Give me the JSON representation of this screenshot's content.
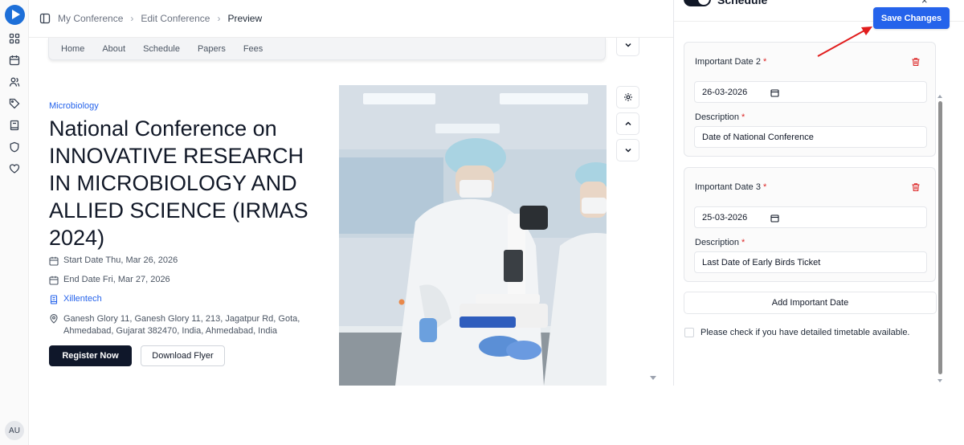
{
  "rail": {
    "avatar_initials": "AU",
    "icons": [
      "grid-icon",
      "calendar-icon",
      "users-icon",
      "tag-icon",
      "book-icon",
      "shield-icon",
      "heart-icon"
    ]
  },
  "breadcrumb": {
    "items": [
      "My Conference",
      "Edit Conference"
    ],
    "current": "Preview"
  },
  "preview": {
    "nav": [
      "Home",
      "About",
      "Schedule",
      "Papers",
      "Fees"
    ],
    "category": "Microbiology",
    "title": "National Conference on INNOVATIVE RESEARCH IN MICROBIOLOGY AND ALLIED SCIENCE (IRMAS 2024)",
    "start_date": "Start Date Thu, Mar 26, 2026",
    "end_date": "End Date Fri, Mar 27, 2026",
    "organizer": "Xillentech",
    "address": "Ganesh Glory 11, Ganesh Glory 11, 213, Jagatpur Rd, Gota, Ahmedabad, Gujarat 382470, India, Ahmedabad, India",
    "register_label": "Register Now",
    "flyer_label": "Download Flyer"
  },
  "panel": {
    "section_title": "Schedule",
    "close_glyph": "×",
    "save_label": "Save Changes",
    "dates": [
      {
        "label": "Important Date 2",
        "date": "26-03-2026",
        "desc_label": "Description",
        "description": "Date of National Conference"
      },
      {
        "label": "Important Date 3",
        "date": "25-03-2026",
        "desc_label": "Description",
        "description": "Last Date of Early Birds Ticket"
      }
    ],
    "required_mark": "*",
    "add_label": "Add Important Date",
    "timetable_label": "Please check if you have detailed timetable available."
  },
  "colors": {
    "primary": "#2563eb",
    "dark_button": "#0f172a",
    "required": "#dc2626",
    "annotation_arrow": "#e11d1d"
  }
}
